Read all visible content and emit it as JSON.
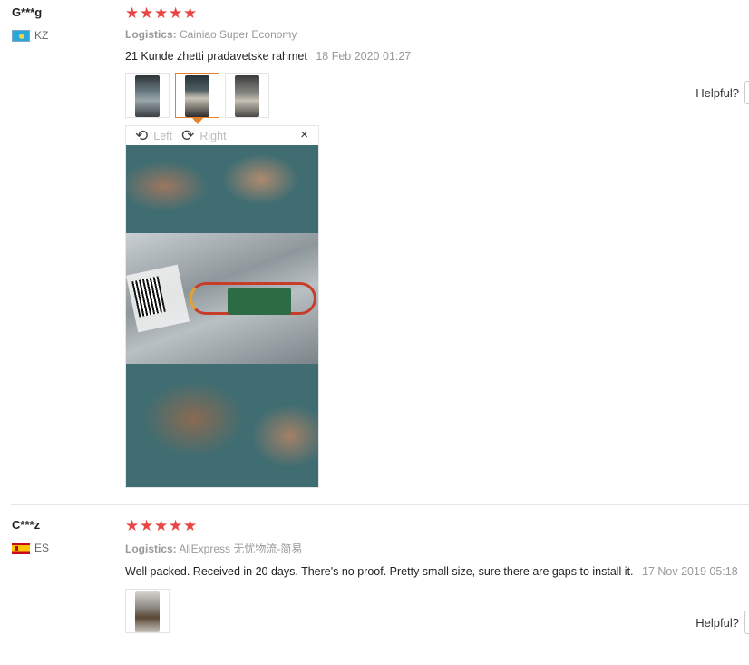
{
  "reviews": [
    {
      "user": "G***g",
      "country_code": "KZ",
      "stars": [
        "★",
        "★",
        "★",
        "★",
        "★"
      ],
      "logistics_label": "Logistics:",
      "logistics_value": "Cainiao Super Economy",
      "feedback": "21 Kunde zhetti pradavetske rahmet",
      "date": "18 Feb 2020 01:27",
      "helpful_label": "Helpful?",
      "viewer": {
        "left_label": "Left",
        "right_label": "Right",
        "left_icon": "⟲",
        "right_icon": "⟳",
        "close_icon": "×"
      }
    },
    {
      "user": "C***z",
      "country_code": "ES",
      "stars": [
        "★",
        "★",
        "★",
        "★",
        "★"
      ],
      "logistics_label": "Logistics:",
      "logistics_value": "AliExpress 无忧物流-简易",
      "feedback": "Well packed. Received in 20 days. There's no proof. Pretty small size, sure there are gaps to install it.",
      "date": "17 Nov 2019 05:18",
      "helpful_label": "Helpful?"
    }
  ],
  "colors": {
    "star": "#e94545",
    "active_thumb": "#e2802d",
    "muted": "#999999"
  }
}
